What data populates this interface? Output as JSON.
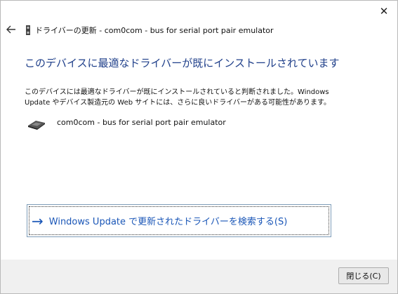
{
  "window": {
    "close_glyph": "✕",
    "back_glyph": "←",
    "title": "ドライバーの更新 - com0com - bus for serial port pair emulator"
  },
  "content": {
    "heading": "このデバイスに最適なドライバーが既にインストールされています",
    "description": "このデバイスには最適なドライバーが既にインストールされていると判断されました。Windows Update やデバイス製造元の Web サイトには、さらに良いドライバーがある可能性があります。",
    "device_name": "com0com - bus for serial port pair emulator",
    "device_icon": "serial-port-device-icon"
  },
  "search": {
    "arrow_glyph": "→",
    "label": "Windows Update で更新されたドライバーを検索する(S)"
  },
  "footer": {
    "close_button_label": "閉じる(C)"
  },
  "colors": {
    "heading": "#1f3f8a",
    "link": "#1a56b7"
  }
}
